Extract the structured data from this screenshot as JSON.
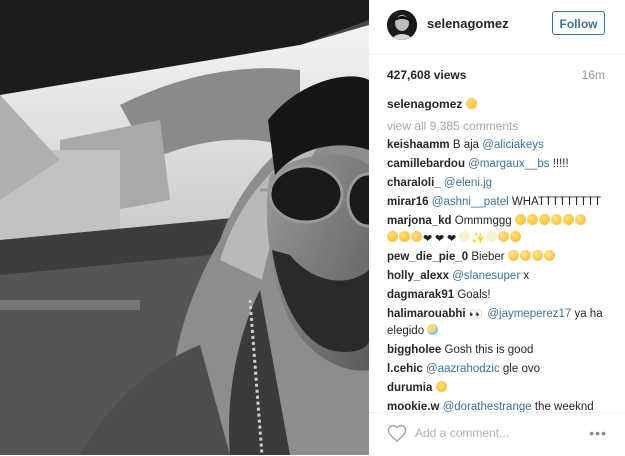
{
  "post": {
    "username": "selenagomez",
    "follow_label": "Follow",
    "views": "427,608 views",
    "time": "16m",
    "caption_user": "selenagomez",
    "view_all": "view all 9,385 comments"
  },
  "comments": [
    {
      "user": "keishaamm",
      "text": "B aja ",
      "mention": "@aliciakeys"
    },
    {
      "user": "camillebardou",
      "mention": "@margaux__bs",
      "text": " !!!!!"
    },
    {
      "user": "charaloli_",
      "mention": "@eleni.jg"
    },
    {
      "user": "mirar16",
      "mention": "@ashni__patel",
      "text": " WHATTTTTTTTT"
    },
    {
      "user": "marjona_kd",
      "text": "Ommmggg"
    },
    {
      "user": "pew_die_pie_0",
      "text": "Bieber"
    },
    {
      "user": "holly_alexx",
      "mention": "@slanesuper",
      "text": " x"
    },
    {
      "user": "dagmarak91",
      "text": "Goals!"
    },
    {
      "user": "halimarouabhi",
      "mention": "@jaymeperez17",
      "text": " ya ha elegido"
    },
    {
      "user": "biggholee",
      "text": "Gosh this is good"
    },
    {
      "user": "l.cehic",
      "mention": "@aazrahodzic",
      "text": " gle ovo"
    },
    {
      "user": "durumia"
    },
    {
      "user": "mookie.w",
      "mention": "@dorathestrange",
      "text": " the weeknd"
    }
  ],
  "add_comment": {
    "placeholder": "Add a comment..."
  },
  "icons": {
    "like": "heart-outline-icon",
    "more": "more-options-icon"
  }
}
